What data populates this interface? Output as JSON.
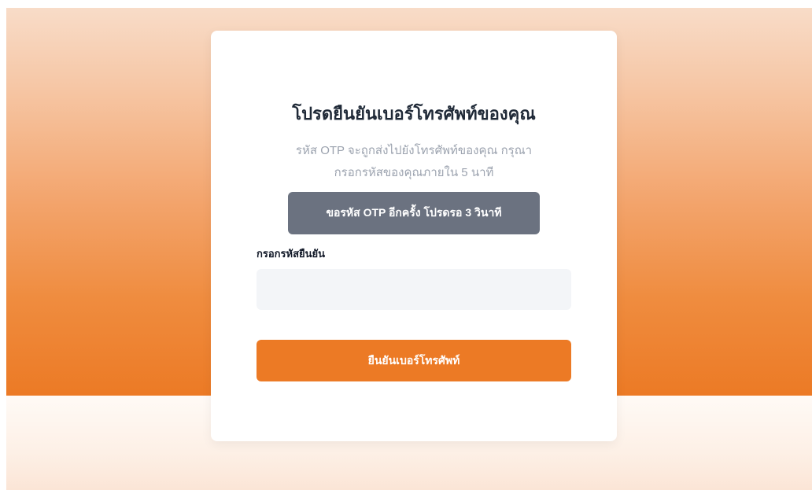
{
  "otp_card": {
    "title": "โปรดยืนยันเบอร์โทรศัพท์ของคุณ",
    "subtitle_line1": "รหัส OTP จะถูกส่งไปยังโทรศัพท์ของคุณ กรุณา",
    "subtitle_line2": "กรอกรหัสของคุณภายใน 5 นาที",
    "resend_button_label": "ขอรหัส OTP อีกครั้ง โปรดรอ 3 วินาที",
    "code_field_label": "กรอกรหัสยืนยัน",
    "code_field_value": "",
    "code_field_placeholder": "",
    "confirm_button_label": "ยืนยันเบอร์โทรศัพท์"
  },
  "colors": {
    "accent": "#ec7a25",
    "disabled_button": "#6b7280",
    "input_background": "#f3f5f8",
    "title_text": "#1f2937",
    "muted_text": "#9ca3af"
  }
}
